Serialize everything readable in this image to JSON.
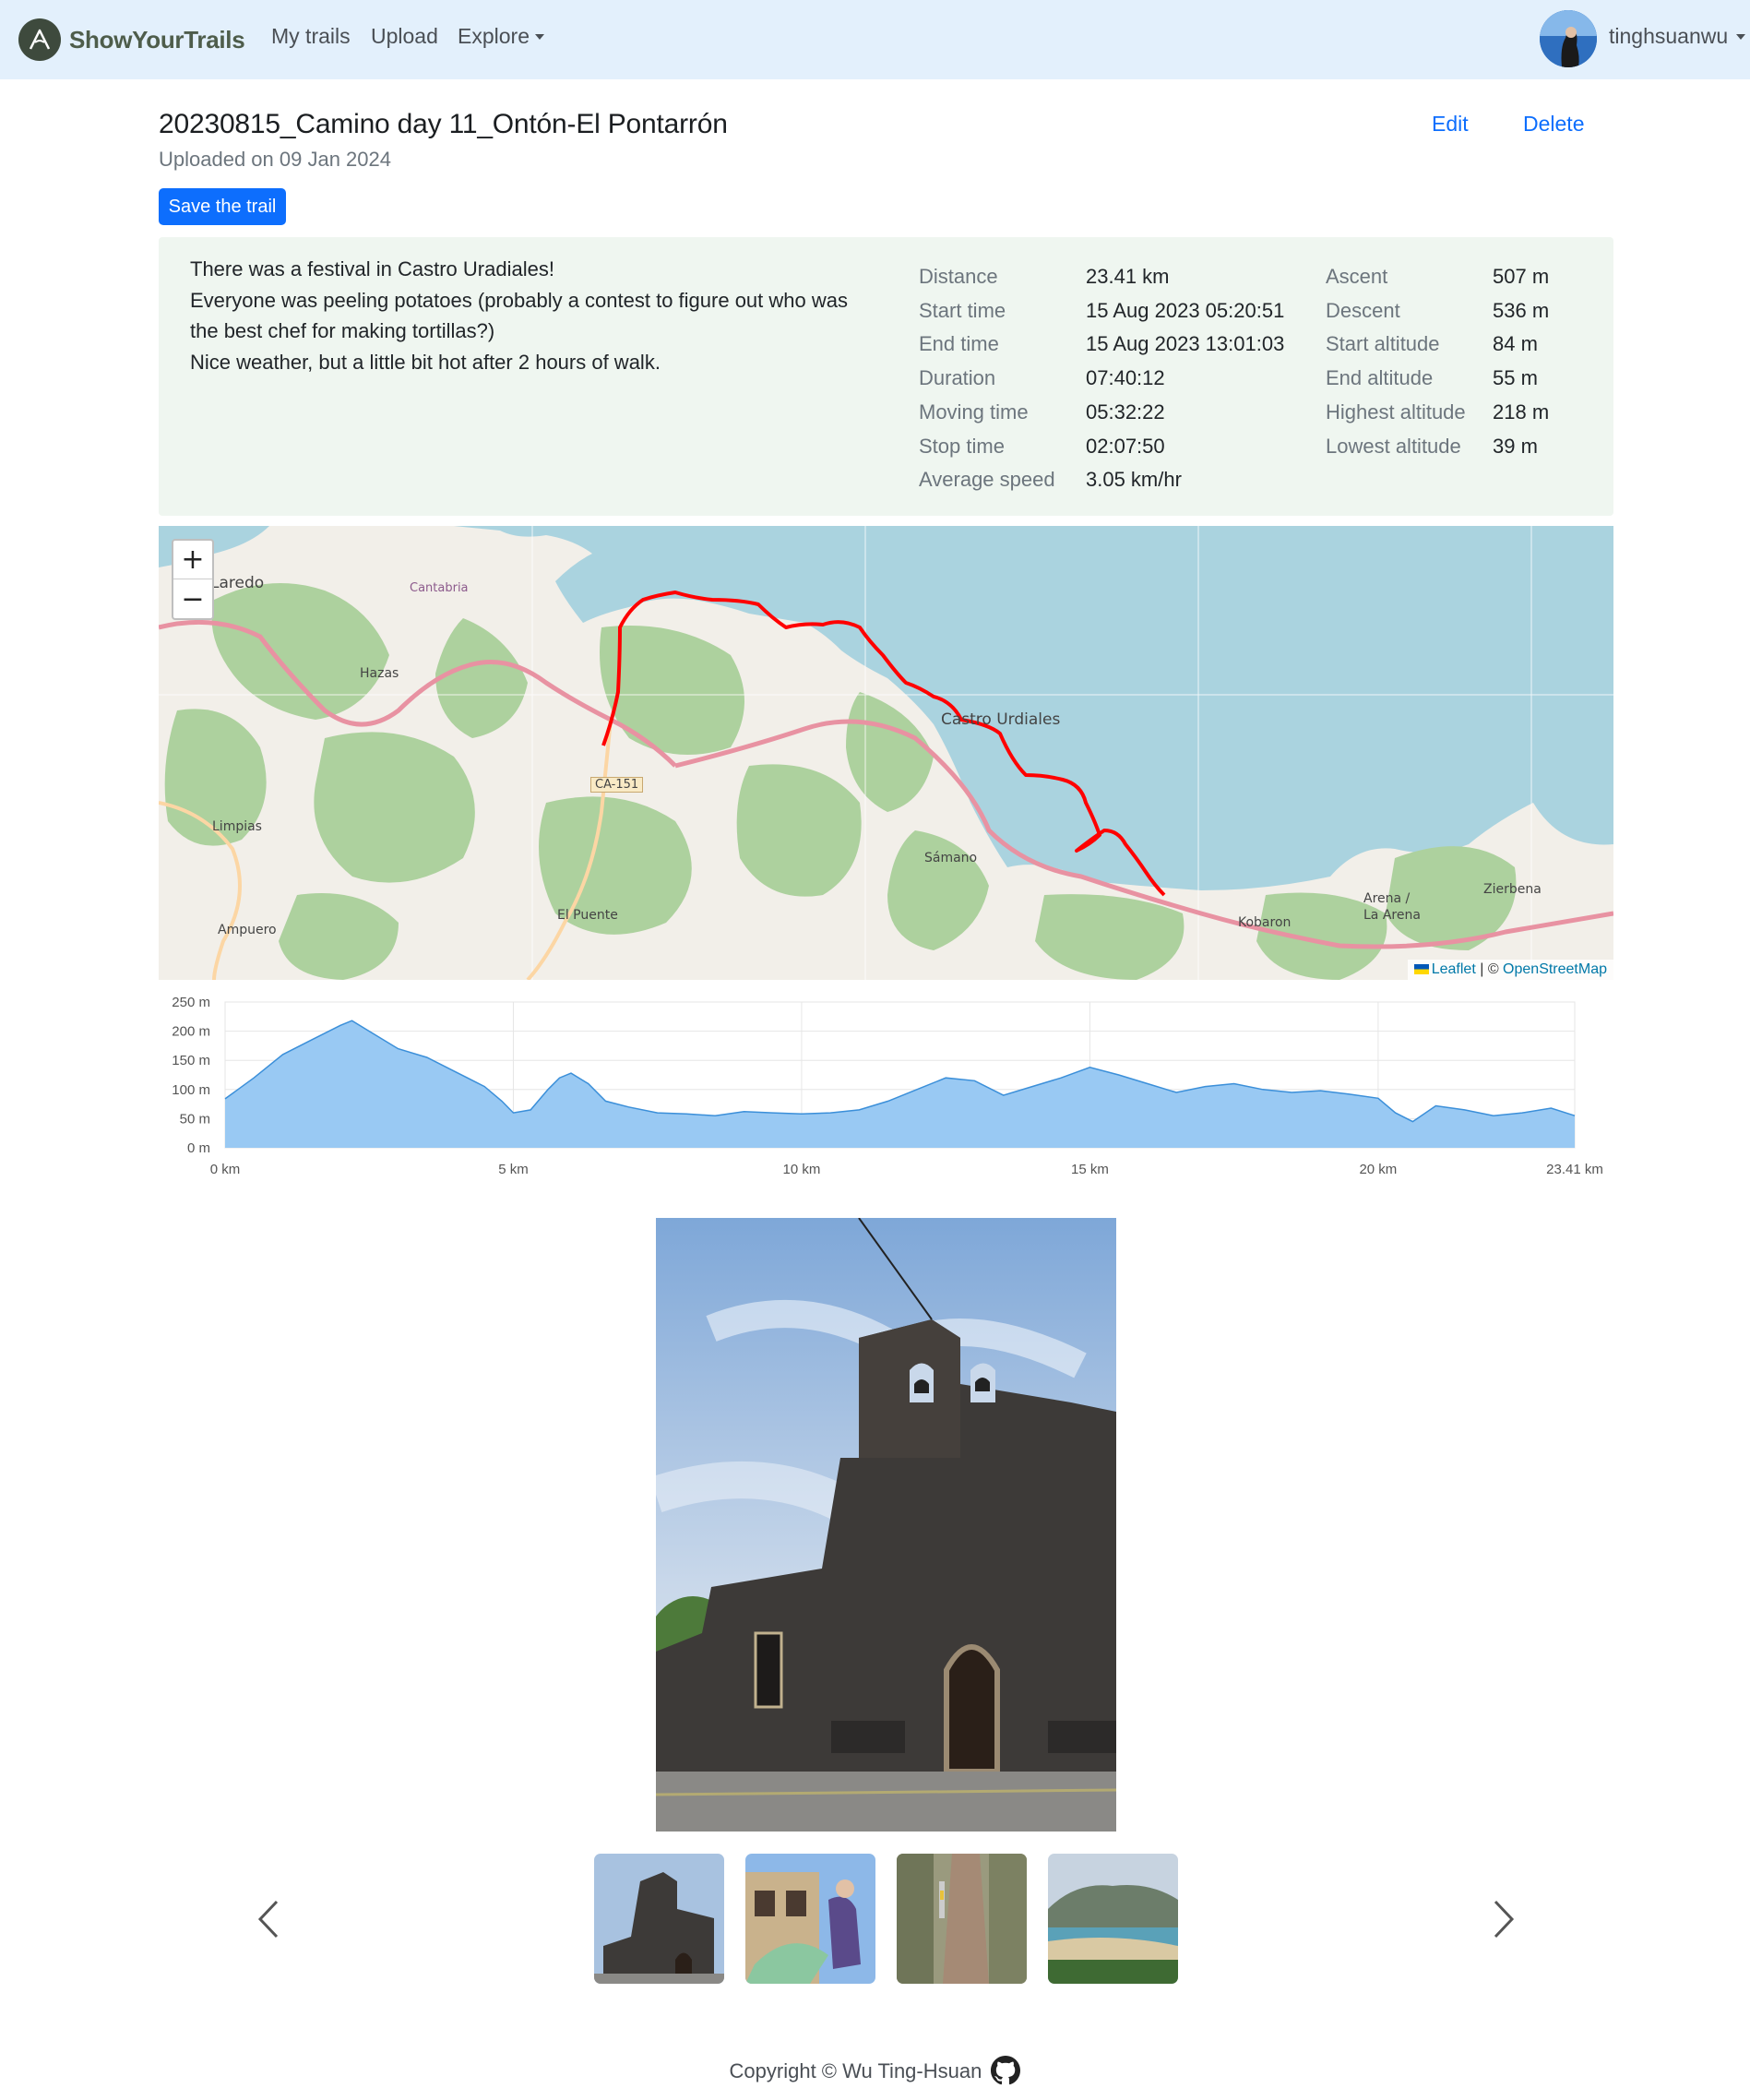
{
  "nav": {
    "brand": "ShowYourTrails",
    "my_trails": "My trails",
    "upload": "Upload",
    "explore": "Explore",
    "username": "tinghsuanwu"
  },
  "trail": {
    "title": "20230815_Camino day 11_Ontón-El Pontarrón",
    "uploaded": "Uploaded on 09 Jan 2024",
    "edit": "Edit",
    "delete": "Delete",
    "save": "Save the trail",
    "description": [
      "There was a festival in Castro Uradiales!",
      "Everyone was peeling potatoes (probably a contest to figure out who was the best chef for making tortillas?)",
      "Nice weather, but a little bit hot after 2 hours of walk."
    ]
  },
  "stats_left": [
    {
      "label": "Distance",
      "value": "23.41 km"
    },
    {
      "label": "Start time",
      "value": "15 Aug 2023 05:20:51"
    },
    {
      "label": "End time",
      "value": "15 Aug 2023 13:01:03"
    },
    {
      "label": "Duration",
      "value": "07:40:12"
    },
    {
      "label": "Moving time",
      "value": "05:32:22"
    },
    {
      "label": "Stop time",
      "value": "02:07:50"
    },
    {
      "label": "Average speed",
      "value": "3.05 km/hr"
    }
  ],
  "stats_right": [
    {
      "label": "Ascent",
      "value": "507 m"
    },
    {
      "label": "Descent",
      "value": "536 m"
    },
    {
      "label": "Start altitude",
      "value": "84 m"
    },
    {
      "label": "End altitude",
      "value": "55 m"
    },
    {
      "label": "Highest altitude",
      "value": "218 m"
    },
    {
      "label": "Lowest altitude",
      "value": "39 m"
    }
  ],
  "map": {
    "zoom_in": "+",
    "zoom_out": "−",
    "attribution_leaflet": "Leaflet",
    "attribution_sep": " | © ",
    "attribution_osm": "OpenStreetMap",
    "places": [
      "Laredo",
      "Cantabria",
      "Hazas",
      "Castro Urdiales",
      "Limpias",
      "Sámano",
      "El Puente",
      "Ampuero",
      "Arena / La Arena",
      "Zierbena",
      "Kobaron",
      "CA-151"
    ],
    "colors": {
      "sea": "#aad3df",
      "land": "#f2efe9",
      "forest": "#add19e",
      "route": "#ff0000"
    }
  },
  "chart_data": {
    "type": "area",
    "x": [
      0,
      0.5,
      1,
      1.5,
      2,
      2.2,
      2.5,
      3,
      3.5,
      4,
      4.5,
      4.8,
      5,
      5.3,
      5.6,
      5.8,
      6,
      6.3,
      6.6,
      7,
      7.5,
      8,
      8.5,
      9,
      9.5,
      10,
      10.5,
      11,
      11.5,
      12,
      12.5,
      13,
      13.5,
      14,
      14.5,
      15,
      15.5,
      16,
      16.5,
      17,
      17.5,
      18,
      18.5,
      19,
      19.5,
      20,
      20.3,
      20.6,
      21,
      21.5,
      22,
      22.5,
      23,
      23.41
    ],
    "y": [
      84,
      120,
      160,
      185,
      210,
      218,
      200,
      170,
      155,
      130,
      105,
      80,
      60,
      65,
      100,
      120,
      128,
      110,
      80,
      70,
      60,
      58,
      55,
      62,
      60,
      58,
      60,
      65,
      80,
      100,
      120,
      115,
      90,
      105,
      120,
      138,
      125,
      110,
      95,
      105,
      110,
      100,
      95,
      98,
      92,
      85,
      60,
      45,
      72,
      65,
      55,
      60,
      68,
      55
    ],
    "xlabel": "",
    "ylabel": "",
    "xlim": [
      0,
      23.41
    ],
    "ylim": [
      0,
      250
    ],
    "x_ticks": [
      "0 km",
      "5 km",
      "10 km",
      "15 km",
      "20 km",
      "23.41 km"
    ],
    "x_tick_values": [
      0,
      5,
      10,
      15,
      20,
      23.41
    ],
    "y_ticks": [
      "0 m",
      "50 m",
      "100 m",
      "150 m",
      "200 m",
      "250 m"
    ],
    "y_tick_values": [
      0,
      50,
      100,
      150,
      200,
      250
    ],
    "grid": true,
    "fill_color": "#99c9f3",
    "line_color": "#3b8fd9"
  },
  "gallery": {
    "thumbnails": [
      "church",
      "festival",
      "path",
      "beach"
    ]
  },
  "footer": {
    "copyright": "Copyright © Wu Ting-Hsuan"
  }
}
